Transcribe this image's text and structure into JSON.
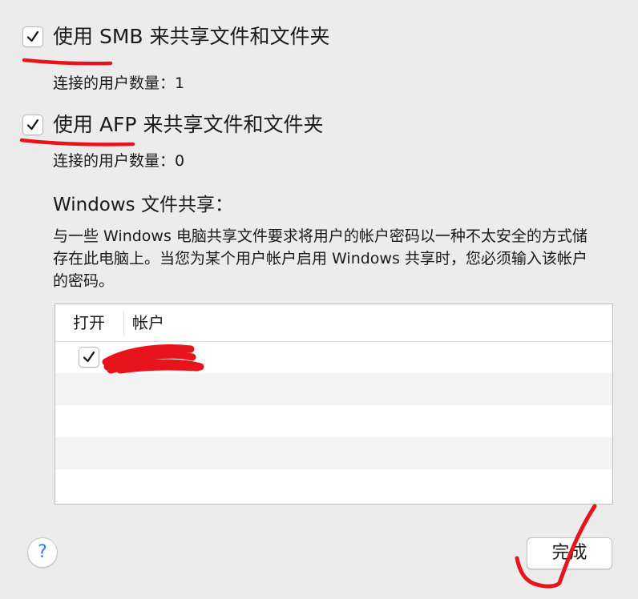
{
  "smb": {
    "checked": true,
    "label": "使用 SMB 来共享文件和文件夹",
    "connected": "连接的用户数量：1"
  },
  "afp": {
    "checked": true,
    "label": "使用 AFP 来共享文件和文件夹",
    "connected": "连接的用户数量：0"
  },
  "windows": {
    "title": "Windows 文件共享：",
    "description": "与一些 Windows 电脑共享文件要求将用户的帐户密码以一种不太安全的方式储存在此电脑上。当您为某个用户帐户启用 Windows 共享时，您必须输入该帐户的密码。",
    "table": {
      "columns": [
        "打开",
        "帐户"
      ],
      "rows": [
        {
          "enabled": true,
          "account": ""
        }
      ]
    }
  },
  "buttons": {
    "help": "?",
    "done": "完成"
  },
  "colors": {
    "annotation": "#e8141b",
    "help_accent": "#2d7cf6"
  }
}
